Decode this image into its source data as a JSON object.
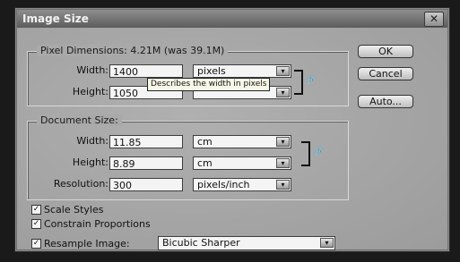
{
  "dialog": {
    "title": "Image Size",
    "close_label": "✕"
  },
  "pixel_dimensions": {
    "legend": "Pixel Dimensions:  4.21M (was 39.1M)",
    "width_label": "Width:",
    "width_value": "1400",
    "width_unit": "pixels",
    "height_label": "Height:",
    "height_value": "1050",
    "tooltip": "Describes the width in pixels"
  },
  "document_size": {
    "legend": "Document Size:",
    "width_label": "Width:",
    "width_value": "11.85",
    "width_unit": "cm",
    "height_label": "Height:",
    "height_value": "8.89",
    "height_unit": "cm",
    "resolution_label": "Resolution:",
    "resolution_value": "300",
    "resolution_unit": "pixels/inch"
  },
  "options": {
    "scale_styles": {
      "label": "Scale Styles",
      "checked": true
    },
    "constrain_proportions": {
      "label": "Constrain Proportions",
      "checked": true
    },
    "resample_image": {
      "label": "Resample Image:",
      "checked": true,
      "method": "Bicubic Sharper"
    }
  },
  "buttons": {
    "ok": "OK",
    "cancel": "Cancel",
    "auto": "Auto..."
  },
  "icons": {
    "dropdown": "▾",
    "check": "✓",
    "link": "🔗"
  }
}
